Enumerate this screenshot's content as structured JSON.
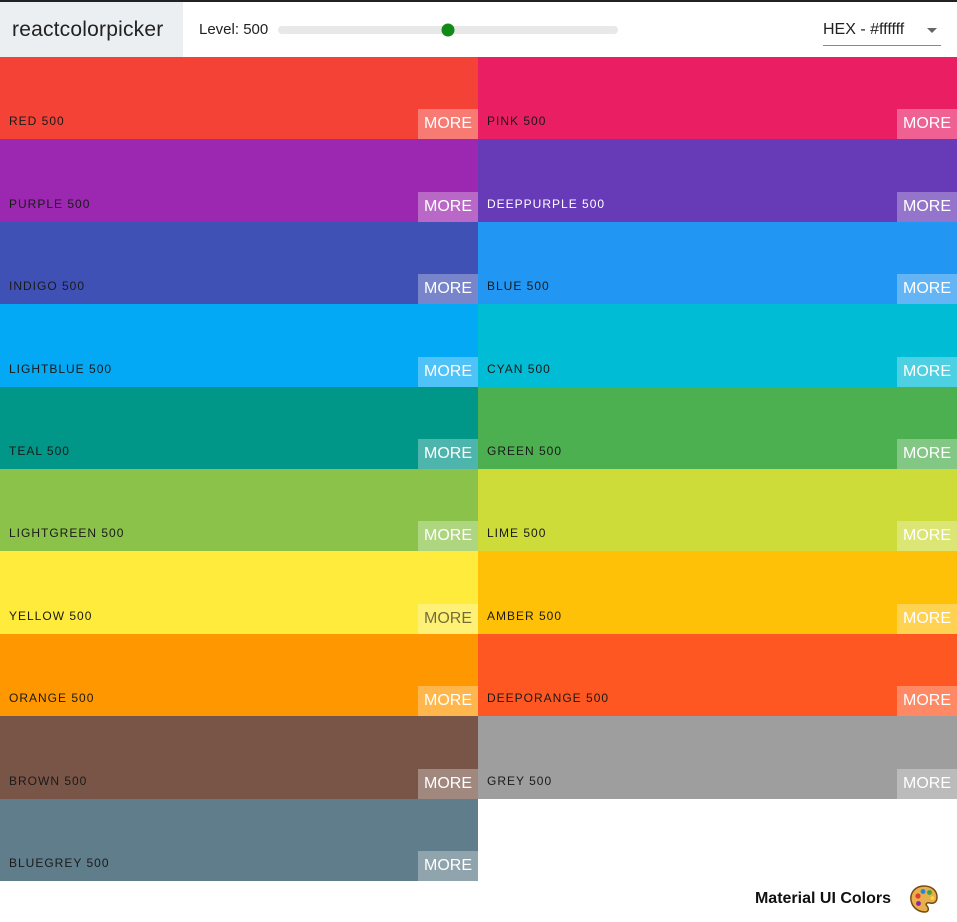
{
  "navbar": {
    "logo": "reactcolorpicker",
    "level_label": "Level: 500",
    "slider_value": 0.5,
    "format_select": "HEX - #ffffff"
  },
  "palette": {
    "colors": [
      {
        "name": "RED 500",
        "hex": "#f44336",
        "more": "MORE",
        "text": "dark"
      },
      {
        "name": "PINK 500",
        "hex": "#e91e63",
        "more": "MORE",
        "text": "dark"
      },
      {
        "name": "PURPLE 500",
        "hex": "#9c27b0",
        "more": "MORE",
        "text": "dark"
      },
      {
        "name": "DEEPPURPLE 500",
        "hex": "#673ab7",
        "more": "MORE",
        "text": "light"
      },
      {
        "name": "INDIGO 500",
        "hex": "#3f51b5",
        "more": "MORE",
        "text": "dark"
      },
      {
        "name": "BLUE 500",
        "hex": "#2196f3",
        "more": "MORE",
        "text": "dark"
      },
      {
        "name": "LIGHTBLUE 500",
        "hex": "#03a9f4",
        "more": "MORE",
        "text": "dark"
      },
      {
        "name": "CYAN 500",
        "hex": "#00bcd4",
        "more": "MORE",
        "text": "dark"
      },
      {
        "name": "TEAL 500",
        "hex": "#009688",
        "more": "MORE",
        "text": "dark"
      },
      {
        "name": "GREEN 500",
        "hex": "#4caf50",
        "more": "MORE",
        "text": "dark"
      },
      {
        "name": "LIGHTGREEN 500",
        "hex": "#8bc34a",
        "more": "MORE",
        "text": "dark"
      },
      {
        "name": "LIME 500",
        "hex": "#cddc39",
        "more": "MORE",
        "text": "dark"
      },
      {
        "name": "YELLOW 500",
        "hex": "#ffeb3b",
        "more": "MORE",
        "text": "dark",
        "more_dark": true
      },
      {
        "name": "AMBER 500",
        "hex": "#ffc107",
        "more": "MORE",
        "text": "dark"
      },
      {
        "name": "ORANGE 500",
        "hex": "#ff9800",
        "more": "MORE",
        "text": "dark"
      },
      {
        "name": "DEEPORANGE 500",
        "hex": "#ff5722",
        "more": "MORE",
        "text": "dark"
      },
      {
        "name": "BROWN 500",
        "hex": "#795548",
        "more": "MORE",
        "text": "dark"
      },
      {
        "name": "GREY 500",
        "hex": "#9e9e9e",
        "more": "MORE",
        "text": "dark"
      },
      {
        "name": "BLUEGREY 500",
        "hex": "#607d8b",
        "more": "MORE",
        "text": "dark"
      }
    ]
  },
  "footer": {
    "title": "Material UI Colors",
    "icon": "artist-palette-icon"
  }
}
